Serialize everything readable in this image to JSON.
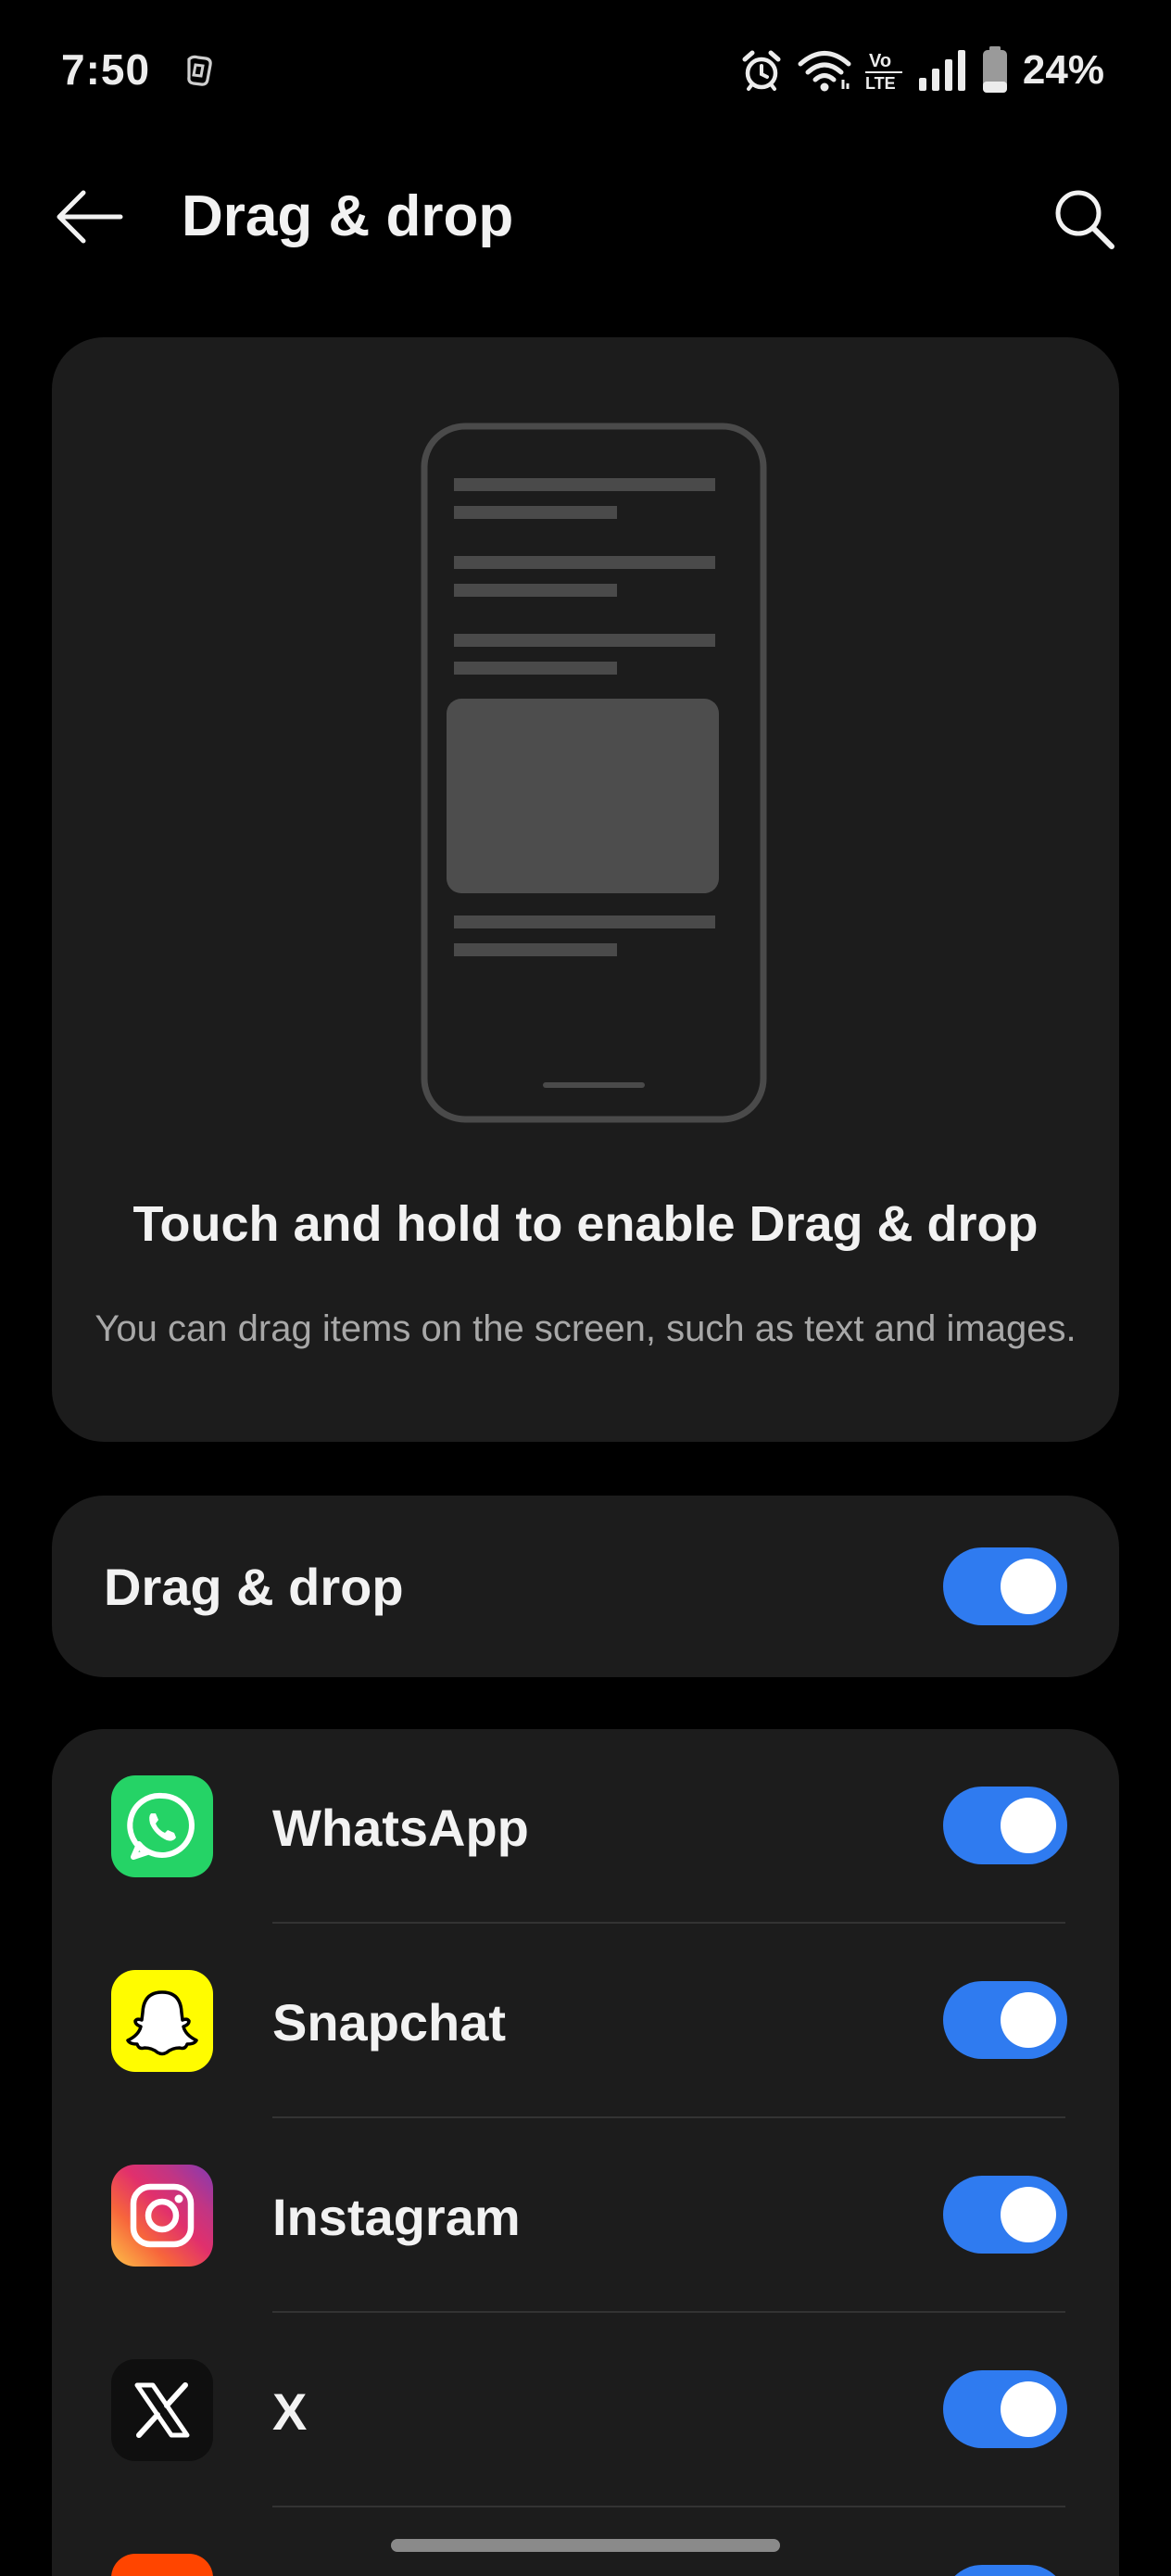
{
  "status_bar": {
    "time": "7:50",
    "battery_text": "24%",
    "icons": [
      "alarm-icon",
      "wifi-icon",
      "volte-icon",
      "signal-icon",
      "battery-icon"
    ]
  },
  "header": {
    "title": "Drag & drop",
    "back_icon": "arrow-left-icon",
    "search_icon": "search-icon"
  },
  "hero": {
    "title": "Touch and hold to enable Drag & drop",
    "description": "You can drag items on the screen, such as text and images."
  },
  "master_toggle": {
    "label": "Drag & drop",
    "enabled": true
  },
  "apps": [
    {
      "name": "WhatsApp",
      "icon": "whatsapp-icon",
      "enabled": true
    },
    {
      "name": "Snapchat",
      "icon": "snapchat-icon",
      "enabled": true
    },
    {
      "name": "Instagram",
      "icon": "instagram-icon",
      "enabled": true
    },
    {
      "name": "X",
      "icon": "x-icon",
      "enabled": true
    }
  ],
  "colors": {
    "background": "#000000",
    "card": "#1c1c1c",
    "toggle_on": "#2f7bf0",
    "whatsapp": "#25d366",
    "snapchat": "#fffc00",
    "x_bg": "#0f0f0f"
  }
}
